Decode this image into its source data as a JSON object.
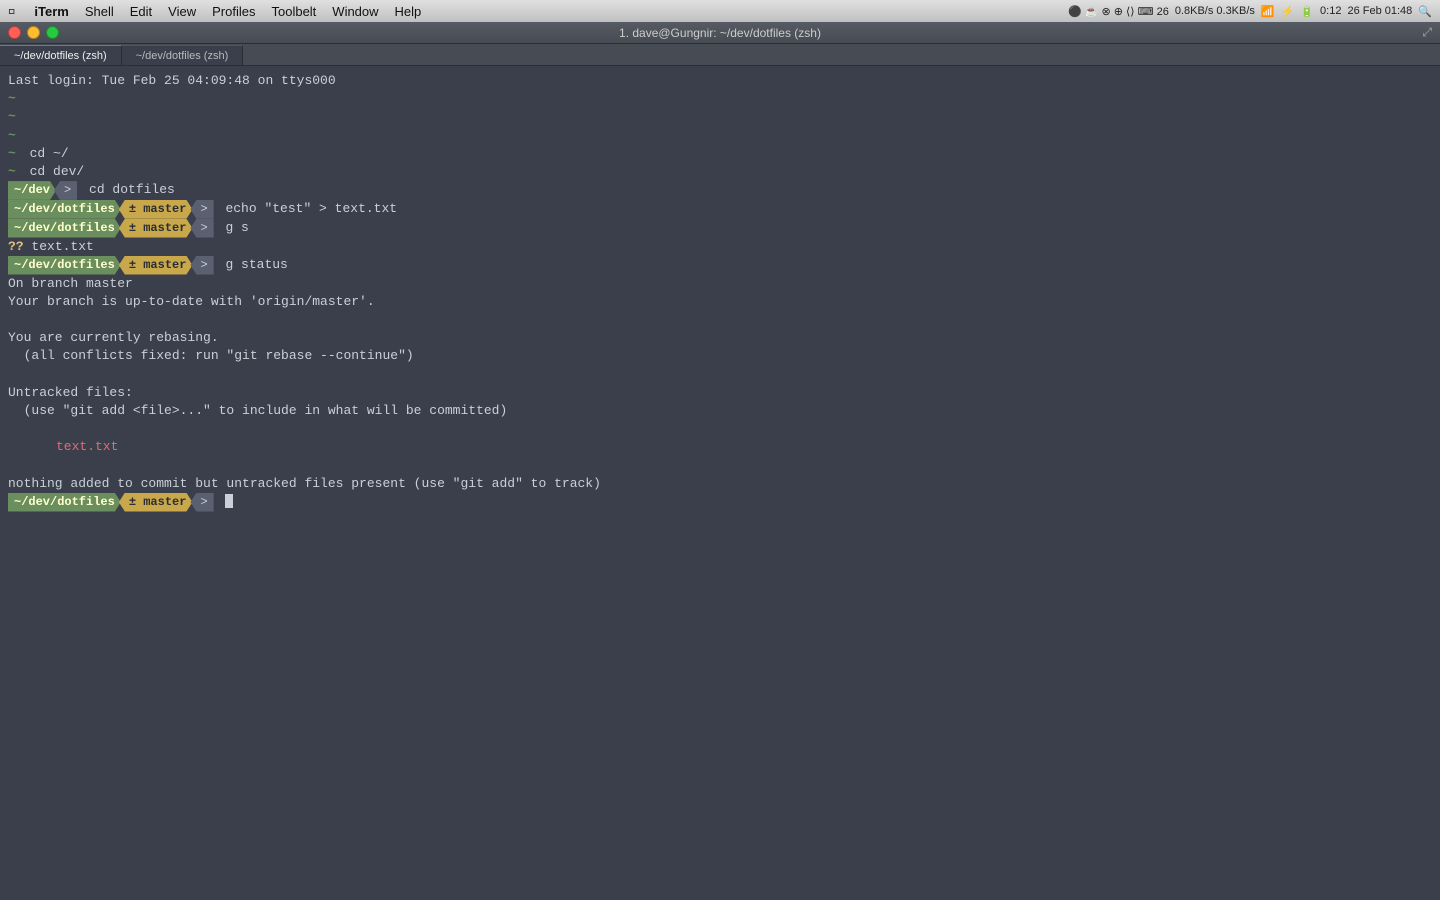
{
  "menubar": {
    "apple": "&#63743;",
    "items": [
      "iTerm",
      "Shell",
      "Edit",
      "View",
      "Profiles",
      "Toolbelt",
      "Window",
      "Help"
    ],
    "right": {
      "network": "0.8KB/s 0.3KB/s",
      "time": "0:12",
      "date": "26 Feb 01:48"
    }
  },
  "titlebar": {
    "title": "1. dave@Gungnir: ~/dev/dotfiles (zsh)"
  },
  "tabs": [
    {
      "label": "~/dev/dotfiles (zsh)",
      "active": true
    },
    {
      "label": "~/dev/dotfiles (zsh)",
      "active": false
    }
  ],
  "terminal": {
    "login_line": "Last login: Tue Feb 25 04:09:48 on ttys000",
    "lines": [
      {
        "type": "tilde_prompt",
        "cmd": ""
      },
      {
        "type": "tilde_prompt",
        "cmd": ""
      },
      {
        "type": "tilde_prompt",
        "cmd": ""
      },
      {
        "type": "tilde_prompt",
        "cmd": "cd ~/"
      },
      {
        "type": "tilde_prompt",
        "cmd": "cd dev/"
      },
      {
        "type": "prompt_dev",
        "path": "~/dev",
        "cmd": "cd dotfiles"
      },
      {
        "type": "prompt_full",
        "path": "~/dev/dotfiles",
        "branch": "± master",
        "cmd": "echo \"test\" > text.txt"
      },
      {
        "type": "prompt_full",
        "path": "~/dev/dotfiles",
        "branch": "± master",
        "cmd": "g s"
      },
      {
        "type": "file_status",
        "marker": "??",
        "file": "text.txt"
      },
      {
        "type": "prompt_full",
        "path": "~/dev/dotfiles",
        "branch": "± master",
        "cmd": "g status"
      },
      {
        "type": "output",
        "text": "On branch master"
      },
      {
        "type": "output",
        "text": "Your branch is up-to-date with 'origin/master'."
      },
      {
        "type": "blank"
      },
      {
        "type": "output",
        "text": "You are currently rebasing."
      },
      {
        "type": "output_indent",
        "text": "(all conflicts fixed: run \"git rebase --continue\")"
      },
      {
        "type": "blank"
      },
      {
        "type": "output",
        "text": "Untracked files:"
      },
      {
        "type": "output_indent",
        "text": "(use \"git add <file>...\" to include in what will be committed)"
      },
      {
        "type": "blank"
      },
      {
        "type": "output_file_red",
        "text": "\ttext.txt"
      },
      {
        "type": "blank"
      },
      {
        "type": "output",
        "text": "nothing added to commit but untracked files present (use \"git add\" to track)"
      },
      {
        "type": "prompt_full_cursor",
        "path": "~/dev/dotfiles",
        "branch": "± master",
        "cmd": ""
      }
    ]
  }
}
